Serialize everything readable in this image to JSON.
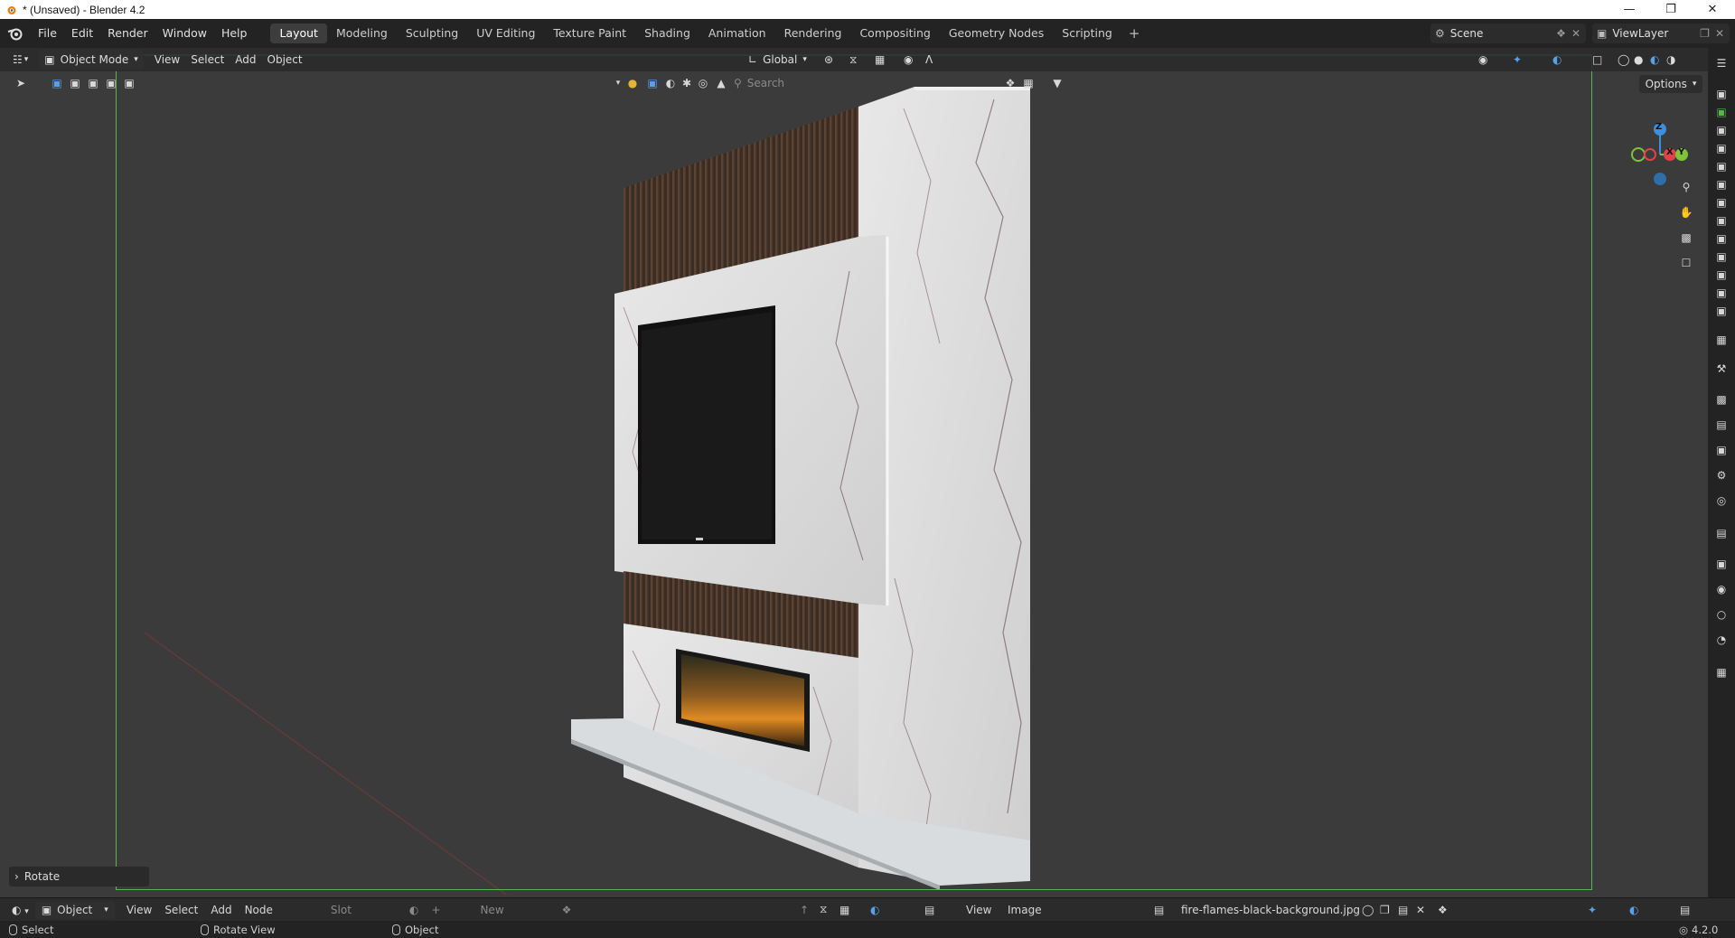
{
  "window": {
    "title": "* (Unsaved) - Blender 4.2"
  },
  "menu": [
    "File",
    "Edit",
    "Render",
    "Window",
    "Help"
  ],
  "workspaces": [
    "Layout",
    "Modeling",
    "Sculpting",
    "UV Editing",
    "Texture Paint",
    "Shading",
    "Animation",
    "Rendering",
    "Compositing",
    "Geometry Nodes",
    "Scripting"
  ],
  "active_workspace": "Layout",
  "scene": {
    "name": "Scene"
  },
  "view_layer": {
    "name": "ViewLayer"
  },
  "viewport_header": {
    "mode": "Object Mode",
    "menus": [
      "View",
      "Select",
      "Add",
      "Object"
    ],
    "orientation": "Global",
    "search_placeholder": "Search",
    "options_label": "Options"
  },
  "last_operator": "Rotate",
  "gizmo": {
    "z": "Z",
    "x": "X",
    "y": "Y"
  },
  "bottom_editor": {
    "mode": "Object",
    "menus": [
      "View",
      "Select",
      "Add",
      "Node"
    ],
    "slot": "Slot",
    "new_label": "New",
    "image_menus": [
      "View",
      "Image"
    ],
    "image_name": "fire-flames-black-background.jpg"
  },
  "status_bar": {
    "select": "Select",
    "rotate_view": "Rotate View",
    "object": "Object",
    "version": "4.2.0"
  },
  "colors": {
    "accent_green": "#57b84f",
    "active_tab_bg": "#3d3d3d",
    "viewport_bg": "#3b3b3b",
    "axis_x": "#e0424c",
    "axis_y": "#7fc33a",
    "axis_z": "#3a8fe0"
  }
}
